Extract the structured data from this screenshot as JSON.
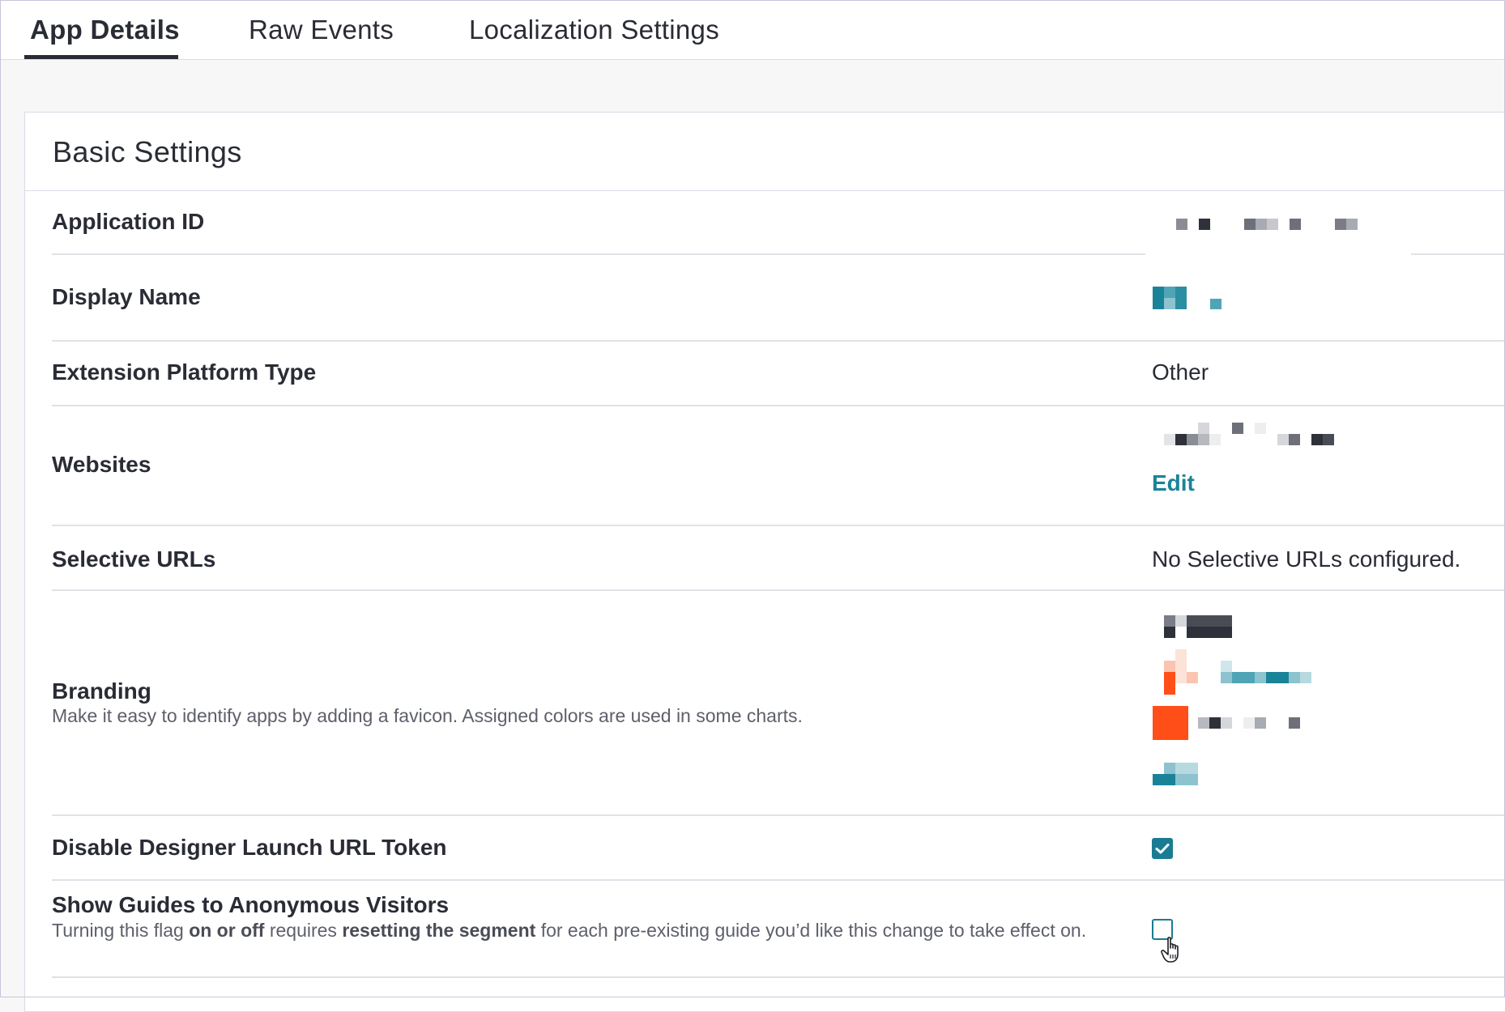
{
  "tabs": [
    {
      "label": "App Details",
      "active": true
    },
    {
      "label": "Raw Events",
      "active": false
    },
    {
      "label": "Localization Settings",
      "active": false
    }
  ],
  "card": {
    "title": "Basic Settings",
    "rows": {
      "application_id": {
        "label": "Application ID"
      },
      "display_name": {
        "label": "Display Name"
      },
      "platform_type": {
        "label": "Extension Platform Type",
        "value": "Other"
      },
      "websites": {
        "label": "Websites",
        "edit_label": "Edit"
      },
      "selective_urls": {
        "label": "Selective URLs",
        "value": "No Selective URLs configured."
      },
      "branding": {
        "label": "Branding",
        "description": "Make it easy to identify apps by adding a favicon. Assigned colors are used in some charts.",
        "colors": {
          "orange": "#ff4e17",
          "teal": "#1a8398"
        }
      },
      "disable_designer_token": {
        "label": "Disable Designer Launch URL Token",
        "checked": true
      },
      "anonymous_visitors": {
        "label": "Show Guides to Anonymous Visitors",
        "desc_part1": "Turning this flag ",
        "desc_bold1": "on or off",
        "desc_part2": " requires ",
        "desc_bold2": "resetting the segment",
        "desc_part3": " for each pre-existing guide you’d like this change to take effect on.",
        "checked": false
      }
    }
  },
  "colors": {
    "accent": "#1a7c92",
    "text": "#2a2c35",
    "muted": "#5d5f6b"
  },
  "icons": {
    "checkbox_check": "check-icon",
    "cursor": "hand-pointer-icon"
  }
}
